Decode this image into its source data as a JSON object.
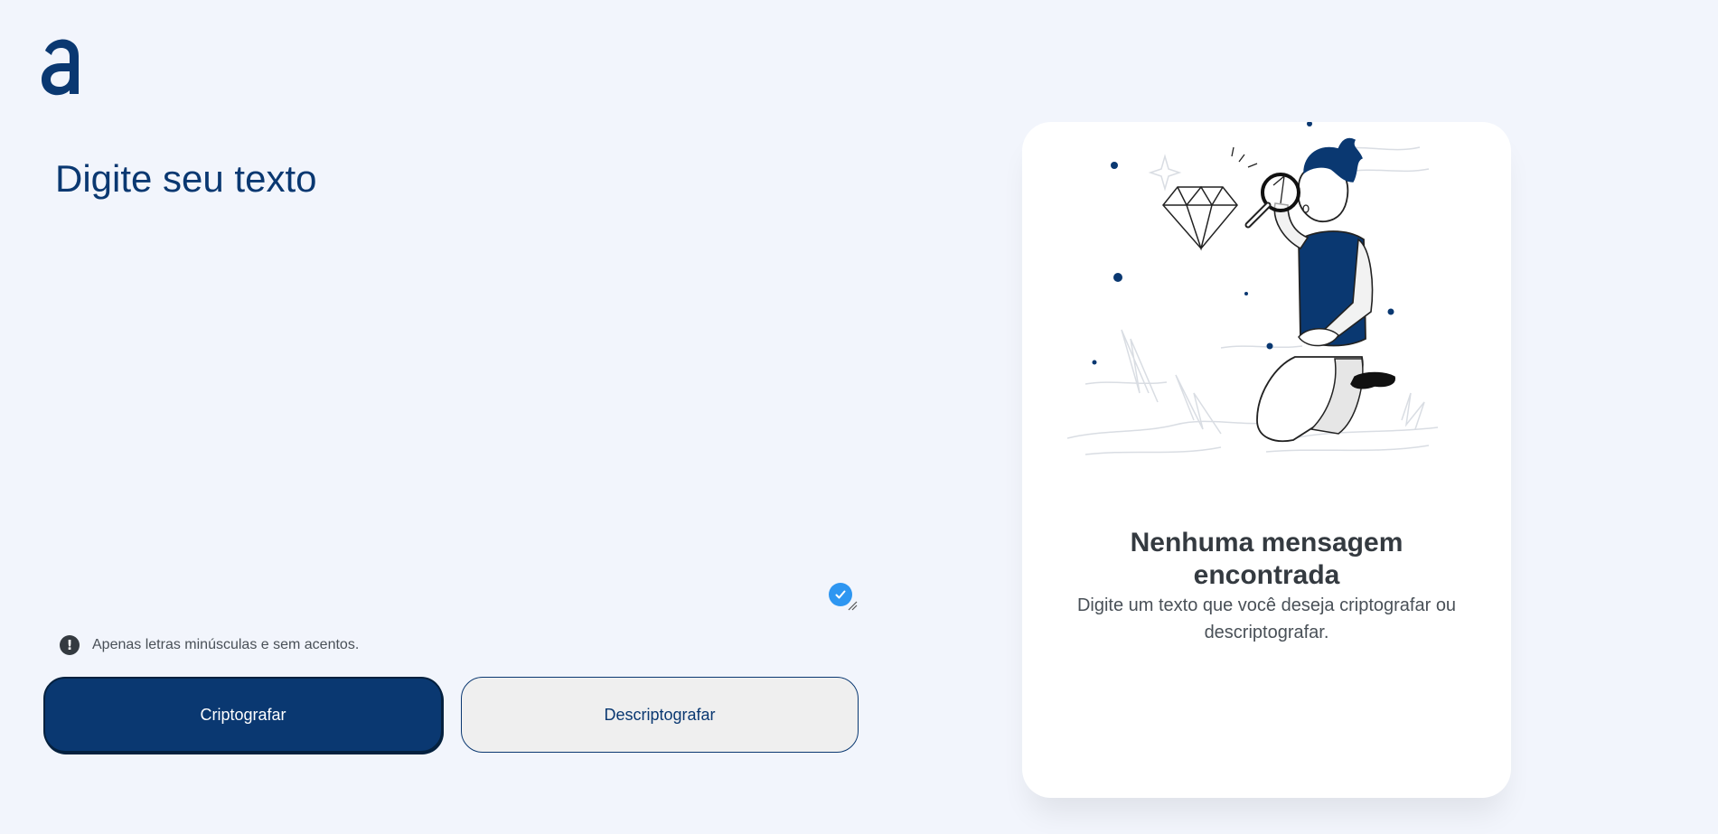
{
  "app": {
    "logo_icon": "alura-logo-icon",
    "accent_color": "#0a3871"
  },
  "input": {
    "placeholder": "Digite seu texto",
    "value": ""
  },
  "hint": {
    "icon": "exclamation-circle-icon",
    "text": "Apenas letras minúsculas e sem acentos."
  },
  "actions": {
    "encrypt_label": "Criptografar",
    "decrypt_label": "Descriptografar"
  },
  "output": {
    "illustration": "boy-with-magnifying-glass-illustration",
    "title": "Nenhuma mensagem encontrada",
    "subtitle": "Digite um texto que você deseja criptografar ou descriptografar."
  }
}
